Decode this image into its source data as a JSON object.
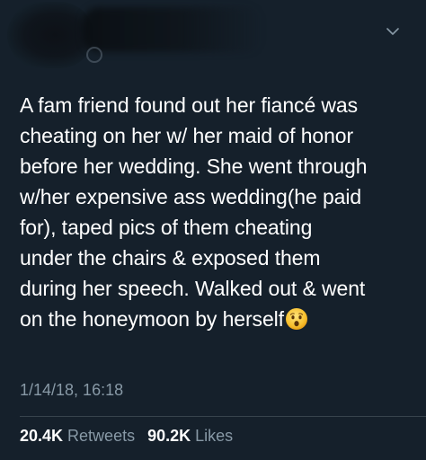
{
  "tweet": {
    "lines": [
      "A fam friend found out her fiancé was",
      "cheating on her w/ her maid of honor",
      "before her wedding. She went through",
      "w/her expensive ass wedding(he paid",
      "for), taped pics of them cheating",
      "under the chairs & exposed them",
      "during her speech. Walked out & went",
      "on the honeymoon by herself"
    ],
    "emoji": "hushed-face-emoji",
    "timestamp": "1/14/18, 16:18"
  },
  "stats": {
    "retweets_count": "20.4K",
    "retweets_label": "Retweets",
    "likes_count": "90.2K",
    "likes_label": "Likes"
  },
  "icons": {
    "more": "chevron-down-icon"
  },
  "colors": {
    "background": "#15202b",
    "text": "#ffffff",
    "secondary_text": "#8899a6",
    "divider": "#38444d"
  }
}
